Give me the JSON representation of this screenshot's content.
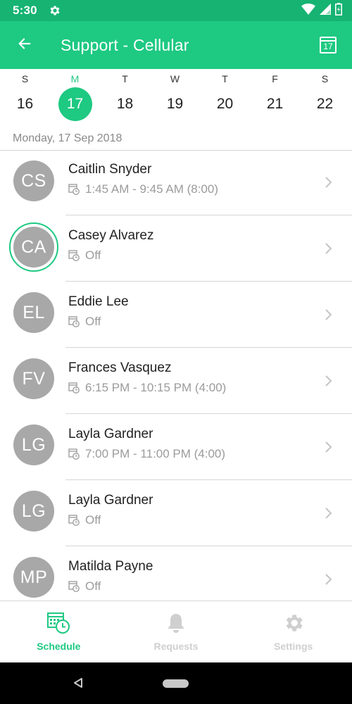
{
  "status_bar": {
    "time": "5:30"
  },
  "app_bar": {
    "title": "Support - Cellular",
    "calendar_day": "17"
  },
  "week": {
    "days": [
      {
        "letter": "S",
        "num": "16",
        "selected": false
      },
      {
        "letter": "M",
        "num": "17",
        "selected": true
      },
      {
        "letter": "T",
        "num": "18",
        "selected": false
      },
      {
        "letter": "W",
        "num": "19",
        "selected": false
      },
      {
        "letter": "T",
        "num": "20",
        "selected": false
      },
      {
        "letter": "F",
        "num": "21",
        "selected": false
      },
      {
        "letter": "S",
        "num": "22",
        "selected": false
      }
    ]
  },
  "date_header": "Monday, 17 Sep 2018",
  "employees": [
    {
      "initials": "CS",
      "name": "Caitlin Snyder",
      "shift": "1:45 AM - 9:45 AM (8:00)",
      "highlighted": false
    },
    {
      "initials": "CA",
      "name": "Casey Alvarez",
      "shift": "Off",
      "highlighted": true
    },
    {
      "initials": "EL",
      "name": "Eddie Lee",
      "shift": "Off",
      "highlighted": false
    },
    {
      "initials": "FV",
      "name": "Frances Vasquez",
      "shift": "6:15 PM - 10:15 PM (4:00)",
      "highlighted": false
    },
    {
      "initials": "LG",
      "name": "Layla Gardner",
      "shift": "7:00 PM - 11:00 PM (4:00)",
      "highlighted": false
    },
    {
      "initials": "LG",
      "name": "Layla Gardner",
      "shift": "Off",
      "highlighted": false
    },
    {
      "initials": "MP",
      "name": "Matilda Payne",
      "shift": "Off",
      "highlighted": false
    }
  ],
  "bottom_nav": {
    "schedule": "Schedule",
    "requests": "Requests",
    "settings": "Settings"
  },
  "colors": {
    "accent": "#1ec982",
    "status_bar": "#16b373",
    "avatar": "#a8a8a8",
    "secondary_text": "#9b9b9b"
  }
}
